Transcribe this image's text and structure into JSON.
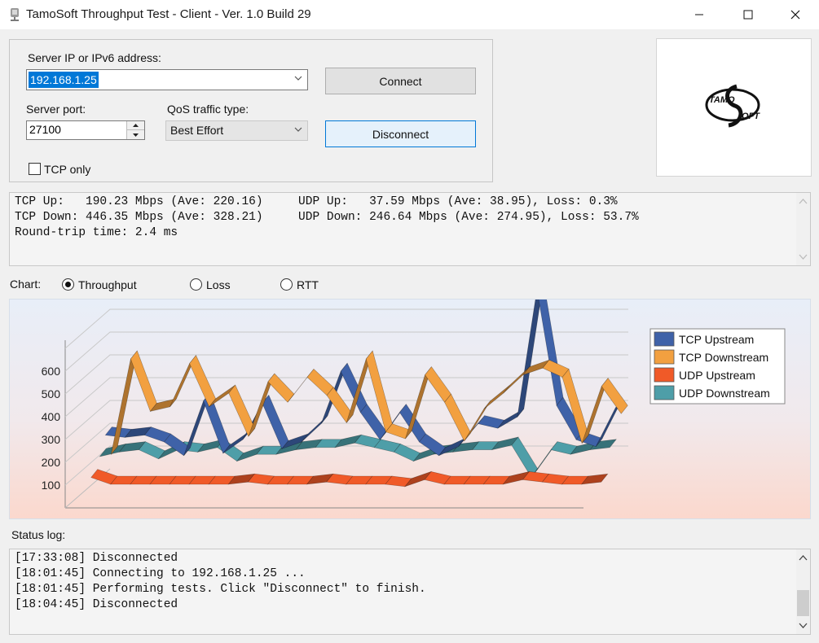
{
  "window": {
    "title": "TamoSoft Throughput Test - Client - Ver. 1.0 Build 29"
  },
  "server": {
    "address_label": "Server IP or IPv6  address:",
    "address_value": "192.168.1.25",
    "port_label": "Server port:",
    "port_value": "27100",
    "qos_label": "QoS traffic type:",
    "qos_value": "Best Effort",
    "tcp_only_label": "TCP only",
    "tcp_only_checked": false
  },
  "buttons": {
    "connect": "Connect",
    "disconnect": "Disconnect"
  },
  "logo": {
    "text_top": "TAMO",
    "text_bottom": "OFT"
  },
  "stats": {
    "lines": [
      "TCP Up:   190.23 Mbps (Ave: 220.16)     UDP Up:   37.59 Mbps (Ave: 38.95), Loss: 0.3%",
      "TCP Down: 446.35 Mbps (Ave: 328.21)     UDP Down: 246.64 Mbps (Ave: 274.95), Loss: 53.7%",
      "Round-trip time: 2.4 ms"
    ]
  },
  "chart_selector": {
    "label": "Chart:",
    "options": [
      "Throughput",
      "Loss",
      "RTT"
    ],
    "selected": "Throughput"
  },
  "chart_data": {
    "type": "line",
    "style": "3d-ribbon",
    "y_ticks": [
      100,
      200,
      300,
      400,
      500,
      600
    ],
    "ylim": [
      0,
      700
    ],
    "grid": true,
    "legend_position": "top-right",
    "series": [
      {
        "name": "TCP Upstream",
        "color": "#3f62a8",
        "values": [
          280,
          270,
          280,
          250,
          190,
          430,
          200,
          260,
          420,
          220,
          250,
          330,
          560,
          380,
          260,
          380,
          250,
          190,
          230,
          330,
          310,
          360,
          920,
          410,
          260,
          230,
          400
        ]
      },
      {
        "name": "TCP Downstream",
        "color": "#f2a040",
        "values": [
          180,
          600,
          370,
          390,
          580,
          390,
          450,
          260,
          500,
          410,
          520,
          440,
          320,
          600,
          280,
          250,
          530,
          410,
          240,
          380,
          450,
          530,
          560,
          520,
          230,
          480,
          360
        ]
      },
      {
        "name": "UDP Upstream",
        "color": "#f05a28",
        "values": [
          130,
          100,
          100,
          100,
          100,
          100,
          100,
          100,
          110,
          100,
          100,
          100,
          110,
          100,
          100,
          100,
          90,
          120,
          100,
          100,
          100,
          100,
          120,
          110,
          100,
          100,
          110
        ]
      },
      {
        "name": "UDP Downstream",
        "color": "#4e9ea8",
        "values": [
          200,
          220,
          230,
          190,
          230,
          220,
          240,
          180,
          210,
          210,
          230,
          240,
          240,
          260,
          240,
          220,
          180,
          210,
          220,
          230,
          230,
          250,
          110,
          230,
          210,
          230,
          240
        ]
      }
    ]
  },
  "status_log": {
    "label": "Status log:",
    "lines": [
      "[17:33:08] Disconnected",
      "[18:01:45] Connecting to 192.168.1.25 ...",
      "[18:01:45] Performing tests. Click \"Disconnect\" to finish.",
      "[18:04:45] Disconnected"
    ]
  }
}
